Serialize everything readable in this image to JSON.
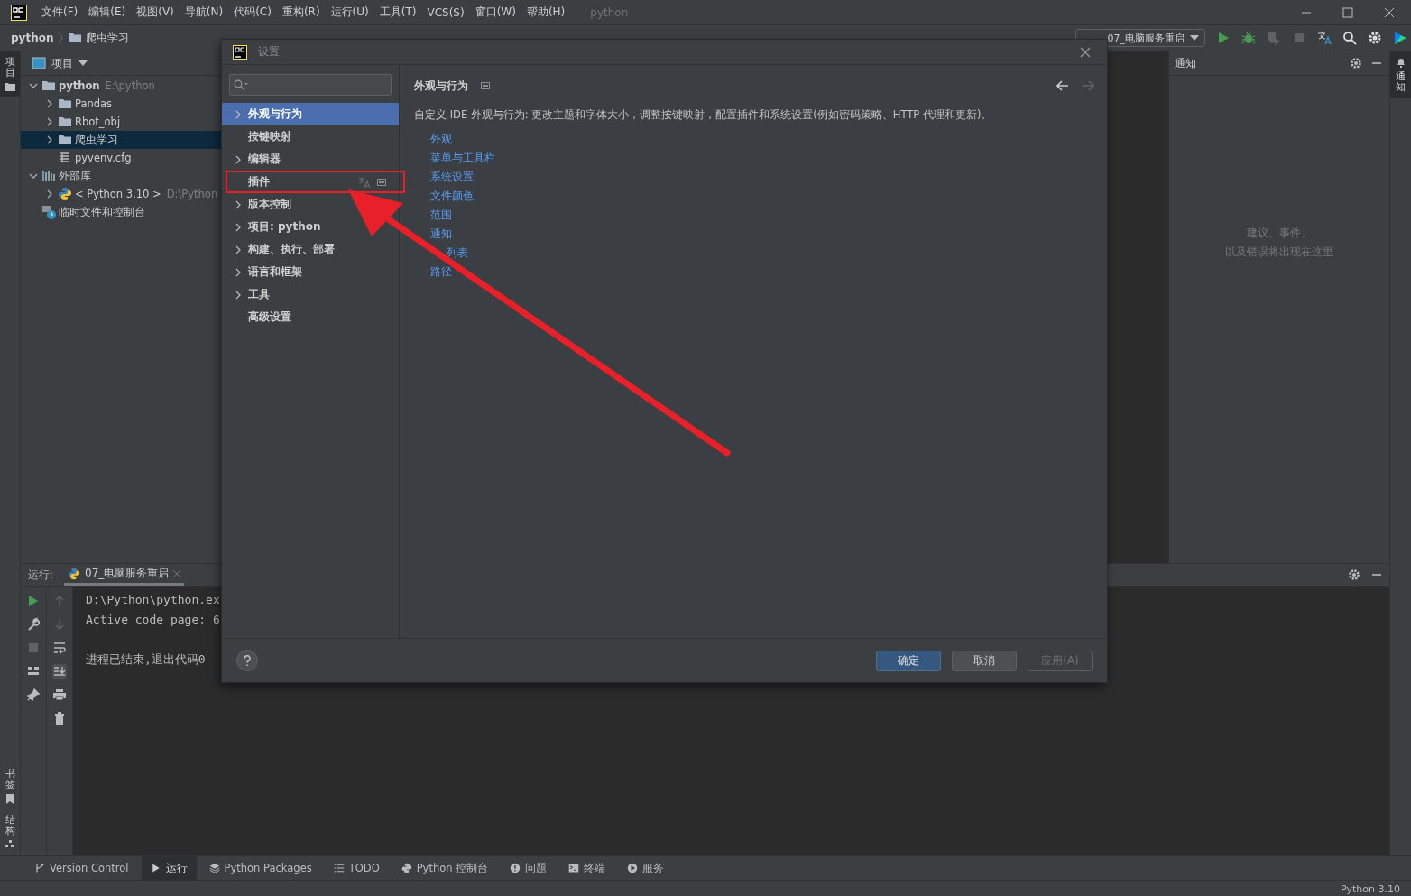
{
  "menu": [
    "文件(F)",
    "编辑(E)",
    "视图(V)",
    "导航(N)",
    "代码(C)",
    "重构(R)",
    "运行(U)",
    "工具(T)",
    "VCS(S)",
    "窗口(W)",
    "帮助(H)"
  ],
  "window_title": "python",
  "breadcrumb": [
    "python",
    "爬虫学习"
  ],
  "run_config": "07_电脑服务重启",
  "left_strip": {
    "top": [
      {
        "label": "项目",
        "selected": true
      }
    ],
    "bottom": [
      {
        "label": "书签",
        "selected": false
      },
      {
        "label": "结构",
        "selected": false
      }
    ]
  },
  "right_strip": [
    {
      "label": "通知",
      "selected": true
    }
  ],
  "project_panel": {
    "title": "项目",
    "tree": [
      {
        "label": "python",
        "hint": "E:\\python",
        "kind": "folder",
        "expanded": true,
        "selected": false,
        "children": [
          {
            "label": "Pandas",
            "kind": "folder",
            "expanded": false,
            "selected": false
          },
          {
            "label": "Rbot_obj",
            "kind": "folder",
            "expanded": false,
            "selected": false
          },
          {
            "label": "爬虫学习",
            "kind": "folder",
            "expanded": false,
            "selected": true
          },
          {
            "label": "pyvenv.cfg",
            "kind": "file",
            "selected": false
          }
        ]
      },
      {
        "label": "外部库",
        "kind": "library",
        "expanded": true,
        "selected": false,
        "children": [
          {
            "label": "< Python 3.10 >",
            "hint": "D:\\Python",
            "kind": "python",
            "expanded": false,
            "selected": false
          }
        ]
      },
      {
        "label": "临时文件和控制台",
        "kind": "scratch",
        "selected": false
      }
    ]
  },
  "notifications": {
    "title": "通知",
    "empty_lines": [
      "建议、事件、",
      "以及错误将出现在这里"
    ]
  },
  "run_panel": {
    "label": "运行:",
    "tab": "07_电脑服务重启",
    "lines": [
      {
        "text": "D:\\Python\\python.ex",
        "kind": "output"
      },
      {
        "text": "Active code page: 6",
        "kind": "output"
      },
      {
        "text": "进程已结束,退出代码0",
        "kind": "status"
      }
    ]
  },
  "tool_windows": [
    {
      "label": "Version Control",
      "kind": "branch",
      "selected": false
    },
    {
      "label": "运行",
      "kind": "run",
      "selected": true
    },
    {
      "label": "Python Packages",
      "kind": "layers",
      "selected": false
    },
    {
      "label": "TODO",
      "kind": "list",
      "selected": false
    },
    {
      "label": "Python 控制台",
      "kind": "python",
      "selected": false
    },
    {
      "label": "问题",
      "kind": "info",
      "selected": false
    },
    {
      "label": "终端",
      "kind": "terminal",
      "selected": false
    },
    {
      "label": "服务",
      "kind": "service",
      "selected": false
    }
  ],
  "status_bar": {
    "interpreter": "Python 3.10"
  },
  "dialog": {
    "title": "设置",
    "nav": [
      {
        "label": "外观与行为",
        "expandable": true,
        "selected": true,
        "annotated": false
      },
      {
        "label": "按键映射",
        "expandable": false,
        "selected": false,
        "annotated": false
      },
      {
        "label": "编辑器",
        "expandable": true,
        "selected": false,
        "annotated": false
      },
      {
        "label": "插件",
        "expandable": false,
        "selected": false,
        "annotated": true
      },
      {
        "label": "版本控制",
        "expandable": true,
        "selected": false,
        "annotated": false
      },
      {
        "label": "项目: python",
        "expandable": true,
        "selected": false,
        "annotated": false
      },
      {
        "label": "构建、执行、部署",
        "expandable": true,
        "selected": false,
        "annotated": false
      },
      {
        "label": "语言和框架",
        "expandable": true,
        "selected": false,
        "annotated": false
      },
      {
        "label": "工具",
        "expandable": true,
        "selected": false,
        "annotated": false
      },
      {
        "label": "高级设置",
        "expandable": false,
        "selected": false,
        "annotated": false
      }
    ],
    "page": {
      "title": "外观与行为",
      "description": "自定义 IDE 外观与行为: 更改主题和字体大小，调整按键映射，配置插件和系统设置(例如密码策略、HTTP 代理和更新)。",
      "links": [
        {
          "text": "外观",
          "kind": "full"
        },
        {
          "text": "菜单与工具栏",
          "kind": "full"
        },
        {
          "text": "系统设置",
          "kind": "full"
        },
        {
          "text": "文件颜色",
          "kind": "full"
        },
        {
          "text": "范围",
          "kind": "full"
        },
        {
          "text": "通知",
          "kind": "full"
        },
        {
          "text": "列表",
          "kind": "covered"
        },
        {
          "text": "路径",
          "kind": "full"
        }
      ]
    },
    "buttons": [
      {
        "label": "确定",
        "kind": "primary"
      },
      {
        "label": "取消",
        "kind": "normal"
      },
      {
        "label": "应用(A)",
        "kind": "disabled"
      }
    ]
  }
}
